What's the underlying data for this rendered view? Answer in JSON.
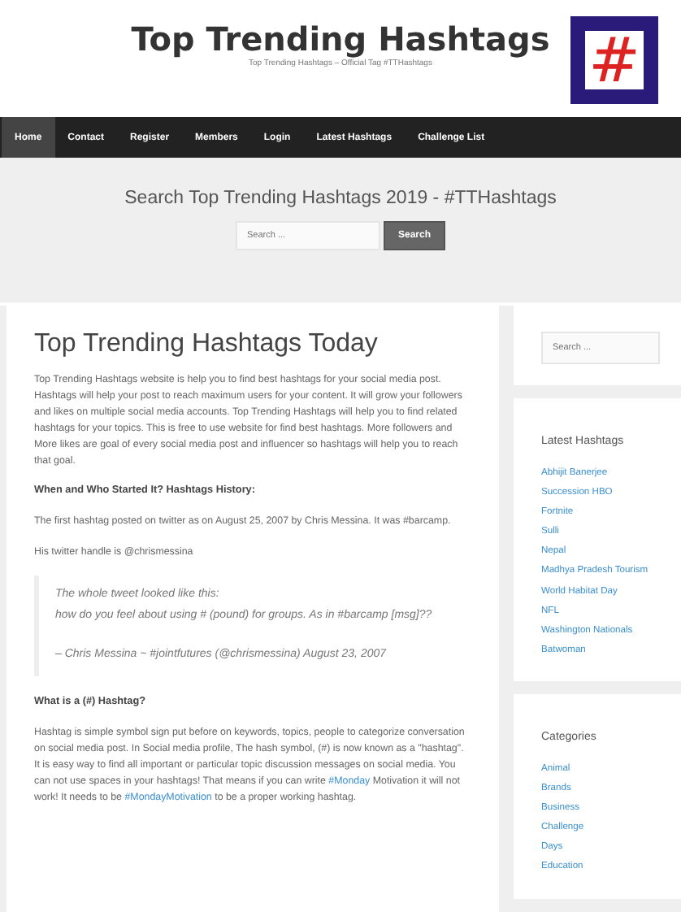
{
  "header": {
    "site_title": "Top Trending Hashtags",
    "tagline": "Top Trending Hashtags – Official Tag #TTHashtags",
    "logo_symbol": "#"
  },
  "nav": [
    {
      "label": "Home",
      "selected": true
    },
    {
      "label": "Contact",
      "selected": false
    },
    {
      "label": "Register",
      "selected": false
    },
    {
      "label": "Members",
      "selected": false
    },
    {
      "label": "Login",
      "selected": false
    },
    {
      "label": "Latest Hashtags",
      "selected": false
    },
    {
      "label": "Challenge List",
      "selected": false
    }
  ],
  "search_band": {
    "heading": "Search Top Trending Hashtags 2019 - #TTHashtags",
    "placeholder": "Search ...",
    "button": "Search"
  },
  "article": {
    "title": "Top Trending Hashtags Today",
    "blocks": [
      {
        "kind": "paragraph",
        "text": "Top Trending Hashtags website is help you to find best hashtags for your social media post. Hashtags will help your post to reach maximum users for your content. It will grow your followers and likes on multiple social media accounts. Top Trending Hashtags will help you to find related hashtags for your topics. This is free to use website for find best hashtags. More followers and More likes are goal of every social media post and influencer so hashtags will help you to reach that goal."
      },
      {
        "kind": "heading",
        "text": "When and Who Started It? Hashtags History:"
      },
      {
        "kind": "paragraph",
        "text": "The first hashtag posted on twitter as on August 25, 2007 by Chris Messina. It was #barcamp."
      },
      {
        "kind": "paragraph",
        "text": "His twitter handle is @chrismessina"
      },
      {
        "kind": "quote",
        "lines": [
          "The whole tweet looked like this:",
          "how do you feel about using # (pound) for groups. As in #barcamp [msg]??"
        ],
        "cite": "– Chris Messina ~ #jointfutures (@chrismessina) August 23, 2007"
      },
      {
        "kind": "heading",
        "text": "What is a (#) Hashtag?"
      },
      {
        "kind": "mixed",
        "parts": [
          {
            "kind": "text",
            "text": "Hashtag is simple symbol sign put before on keywords, topics, people to categorize conversation on social media post. In Social media profile, The hash symbol, (#) is now known as a \"hashtag\". It is easy way to find all important or particular topic discussion messages on social media. You can not use spaces in your hashtags! That means if you can write "
          },
          {
            "kind": "link",
            "text": "#Monday"
          },
          {
            "kind": "text",
            "text": " Motivation it will not work! It needs to be "
          },
          {
            "kind": "link",
            "text": "#MondayMotivation"
          },
          {
            "kind": "text",
            "text": " to be a proper working hashtag."
          }
        ]
      }
    ]
  },
  "sidebar": {
    "search_placeholder": "Search ...",
    "widgets": [
      {
        "title": "Latest Hashtags",
        "links": [
          "Abhijit Banerjee",
          "Succession HBO",
          "Fortnite",
          "Sulli",
          "Nepal",
          "Madhya Pradesh Tourism",
          "World Habitat Day",
          "NFL",
          "Washington Nationals",
          "Batwoman"
        ]
      },
      {
        "title": "Categories",
        "links": [
          "Animal",
          "Brands",
          "Business",
          "Challenge",
          "Days",
          "Education"
        ]
      }
    ]
  }
}
